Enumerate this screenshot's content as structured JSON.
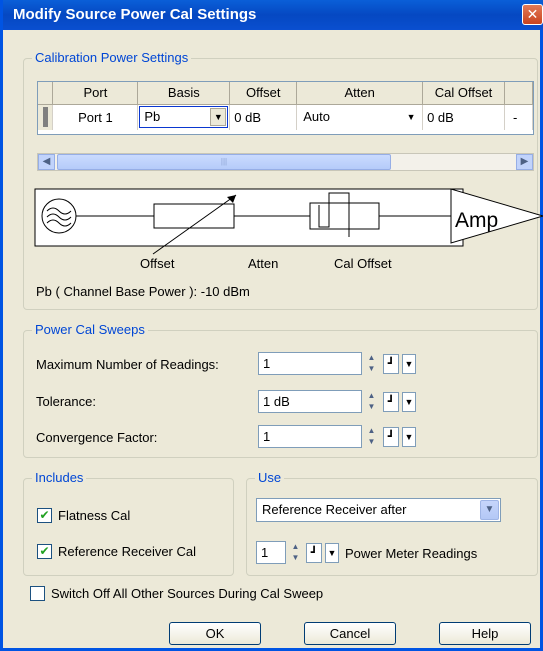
{
  "window": {
    "title": "Modify Source Power Cal Settings",
    "close": "✕"
  },
  "calibration": {
    "group_title": "Calibration Power Settings",
    "columns": [
      "Port",
      "Basis",
      "Offset",
      "Atten",
      "Cal Offset"
    ],
    "row": {
      "port": "Port 1",
      "basis": "Pb",
      "offset": "0 dB",
      "atten": "Auto",
      "cal_offset": "0 dB",
      "extra": "-"
    },
    "diagram": {
      "amp": "Amp",
      "labels": {
        "offset": "Offset",
        "atten": "Atten",
        "cal_offset": "Cal Offset"
      }
    },
    "base_power": "Pb ( Channel Base Power ): -10 dBm"
  },
  "sweeps": {
    "group_title": "Power Cal Sweeps",
    "max_readings_label": "Maximum Number of Readings:",
    "max_readings_value": "1",
    "tolerance_label": "Tolerance:",
    "tolerance_value": "1 dB",
    "convergence_label": "Convergence Factor:",
    "convergence_value": "1"
  },
  "includes": {
    "group_title": "Includes",
    "flatness_label": "Flatness Cal",
    "flatness_checked": true,
    "ref_receiver_label": "Reference Receiver Cal",
    "ref_receiver_checked": true
  },
  "use": {
    "group_title": "Use",
    "selected": "Reference Receiver after",
    "readings_value": "1",
    "readings_label": "Power Meter Readings"
  },
  "switch_off": {
    "label": "Switch Off All Other Sources During Cal Sweep",
    "checked": false
  },
  "buttons": {
    "ok": "OK",
    "cancel": "Cancel",
    "help": "Help"
  },
  "colors": {
    "title_bar": "#0548c2",
    "group_title": "#0046d5",
    "check": "#21a121"
  }
}
